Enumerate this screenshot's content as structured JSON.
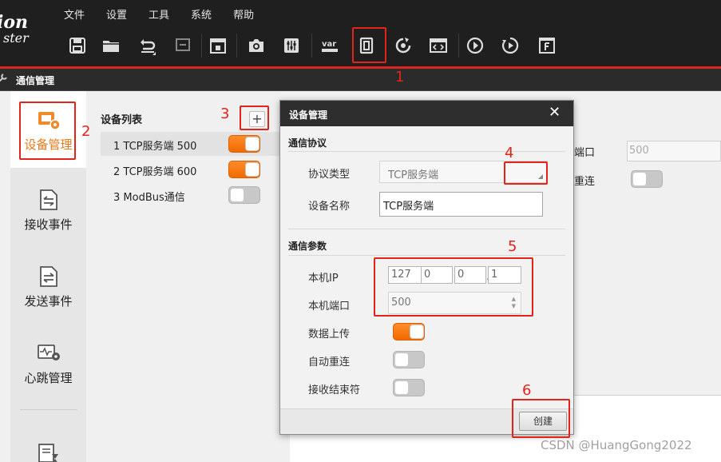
{
  "app": {
    "logo_text": "ion",
    "logo_subtext": "ster"
  },
  "menu": [
    "文件",
    "设置",
    "工具",
    "系统",
    "帮助"
  ],
  "toolbar_icons": [
    "save-icon",
    "open-folder-icon",
    "undo-icon",
    "redo-icon",
    "lock-icon",
    "camera-icon",
    "adjust-icon",
    "var-icon",
    "device-comm-icon",
    "refresh-icon",
    "code-window-icon",
    "run-once-icon",
    "run-loop-icon",
    "form-icon"
  ],
  "toolbar_var_label": "var",
  "panel": {
    "title": "通信管理"
  },
  "nav": {
    "items": [
      {
        "label": "设备管理",
        "icon": "device-manage-icon",
        "active": true
      },
      {
        "label": "接收事件",
        "icon": "receive-event-icon",
        "active": false
      },
      {
        "label": "发送事件",
        "icon": "send-event-icon",
        "active": false
      },
      {
        "label": "心跳管理",
        "icon": "heartbeat-icon",
        "active": false
      }
    ]
  },
  "device_list": {
    "title": "设备列表",
    "add_label": "+",
    "items": [
      {
        "name": "1 TCP服务端 500",
        "enabled": true
      },
      {
        "name": "2 TCP服务端 600",
        "enabled": true
      },
      {
        "name": "3 ModBus通信",
        "enabled": false
      }
    ]
  },
  "background_form": {
    "port_label": "端口",
    "port_value": "500",
    "reconnect_label": "重连"
  },
  "dialog": {
    "title": "设备管理",
    "close": "✕",
    "protocol_section": "通信协议",
    "protocol_type_label": "协议类型",
    "protocol_type_value": "TCP服务端",
    "device_name_label": "设备名称",
    "device_name_value": "TCP服务端",
    "params_section": "通信参数",
    "local_ip_label": "本机IP",
    "ip": [
      "127",
      "0",
      "0",
      "1"
    ],
    "local_port_label": "本机端口",
    "local_port_value": "500",
    "data_upload_label": "数据上传",
    "data_upload_on": true,
    "auto_reconnect_label": "自动重连",
    "auto_reconnect_on": false,
    "terminator_label": "接收结束符",
    "terminator_on": false,
    "create_label": "创建"
  },
  "annotations": [
    "1",
    "2",
    "3",
    "4",
    "5",
    "6"
  ],
  "watermark": "CSDN @HuangGong2022",
  "colors": {
    "accent_orange": "#f07a1a",
    "annotation_red": "#e3241b",
    "chrome_dark": "#1f1f1f"
  }
}
